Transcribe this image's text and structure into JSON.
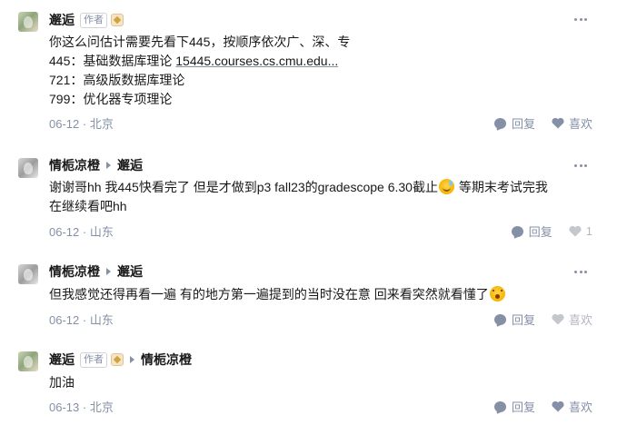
{
  "comments": [
    {
      "name": "邂逅",
      "author_tag": "作者",
      "has_badge": true,
      "reply_to": "",
      "lines": [
        "你这么问估计需要先看下445，按顺序依次广、深、专",
        "445：基础数据库理论 ",
        "721：高级版数据库理论",
        "799：优化器专项理论"
      ],
      "link_text": "15445.courses.cs.cmu.edu...",
      "date": "06-12",
      "location": "北京",
      "reply_label": "回复",
      "like_label": "喜欢"
    },
    {
      "name": "情栀凉橙",
      "reply_to": "邂逅",
      "lines": [
        "谢谢哥hh 我445快看完了 但是才做到p3 fall23的gradescope 6.30截止",
        " 等期末考试完我",
        "在继续看吧hh"
      ],
      "date": "06-12",
      "location": "山东",
      "reply_label": "回复",
      "like_label": "1"
    },
    {
      "name": "情栀凉橙",
      "reply_to": "邂逅",
      "lines": [
        "但我感觉还得再看一遍 有的地方第一遍提到的当时没在意 回来看突然就看懂了"
      ],
      "date": "06-12",
      "location": "山东",
      "reply_label": "回复",
      "like_label": "喜欢"
    },
    {
      "name": "邂逅",
      "author_tag": "作者",
      "has_badge": true,
      "reply_to": "情栀凉橙",
      "lines": [
        "加油"
      ],
      "date": "06-13",
      "location": "北京",
      "reply_label": "回复",
      "like_label": "喜欢"
    }
  ],
  "separator": " · ",
  "icons": {
    "more": "more-dots-icon",
    "reply": "comment-bubble-icon",
    "like": "heart-icon",
    "reply_arrow": "triangle-right-icon",
    "badge": "creator-badge-icon",
    "emoji_1": "sweat-smile-emoji",
    "emoji_2": "surprised-emoji"
  },
  "colors": {
    "text": "#191919",
    "meta": "#8590a6",
    "muted": "#c4c7ce"
  }
}
